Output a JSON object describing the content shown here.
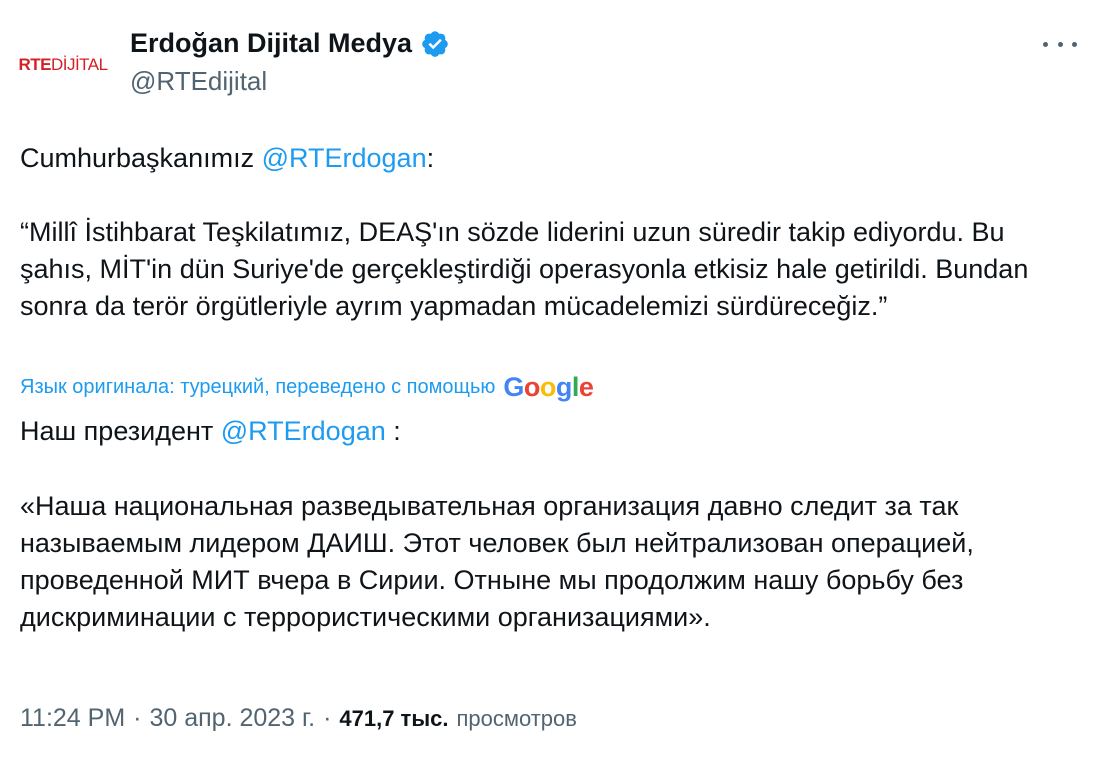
{
  "author": {
    "avatar_text_bold": "RTE",
    "avatar_text_light": "DİJİTAL",
    "display_name": "Erdoğan Dijital Medya",
    "handle": "@RTEdijital",
    "verified_icon": "verified-badge-icon",
    "more_icon": "more-options-icon"
  },
  "original": {
    "intro_prefix": "Cumhurbaşkanımız ",
    "mention": "@RTErdogan",
    "intro_suffix": ":",
    "quote": "“Millî İstihbarat Teşkilatımız, DEAŞ'ın sözde liderini uzun süredir takip ediyordu. Bu şahıs, MİT'in dün Suriye'de gerçekleştirdiği operasyonla etkisiz hale getirildi. Bundan sonra da terör örgütleriyle ayrım yapmadan mücadelemizi sürdüreceğiz.”"
  },
  "translation": {
    "notice": "Язык оригинала: турецкий, переведено с помощью",
    "provider": "Google",
    "intro_prefix": "Наш президент ",
    "mention": "@RTErdogan",
    "intro_suffix": " :",
    "quote": "«Наша национальная разведывательная организация давно следит за так называемым лидером ДАИШ. Этот человек был нейтрализован операцией, проведенной МИТ вчера в Сирии. Отныне мы продолжим нашу борьбу без дискриминации с террористическими организациями»."
  },
  "meta": {
    "time": "11:24 PM",
    "separator": "·",
    "date": "30 апр. 2023 г.",
    "views_count": "471,7 тыс.",
    "views_label": "просмотров"
  },
  "colors": {
    "link": "#1d9bf0",
    "text": "#0f1419",
    "secondary": "#536471",
    "brand_red": "#d42027"
  }
}
